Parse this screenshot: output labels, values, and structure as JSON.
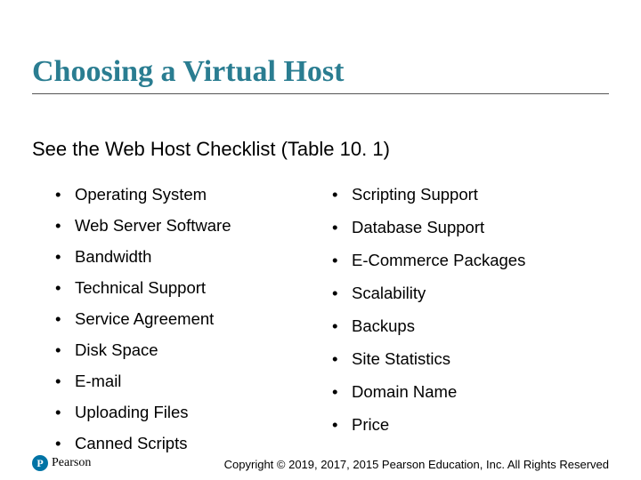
{
  "title": "Choosing a Virtual Host",
  "subtitle": "See the Web Host Checklist (Table 10. 1)",
  "left_items": [
    "Operating System",
    "Web Server Software",
    "Bandwidth",
    "Technical Support",
    "Service Agreement",
    "Disk Space",
    "E-mail",
    "Uploading Files",
    "Canned Scripts"
  ],
  "right_items": [
    "Scripting Support",
    "Database Support",
    "E-Commerce Packages",
    "Scalability",
    "Backups",
    "Site Statistics",
    "Domain Name",
    "Price"
  ],
  "footer": "Copyright © 2019, 2017, 2015 Pearson Education, Inc. All Rights Reserved",
  "logo": {
    "letter": "P",
    "name": "Pearson"
  }
}
